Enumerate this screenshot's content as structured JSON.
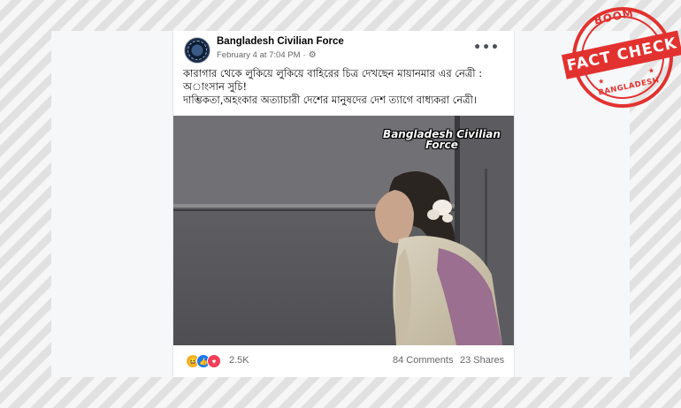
{
  "post": {
    "page_name": "Bangladesh Civilian Force",
    "timestamp": "February 4 at 7:04 PM",
    "separator": "·",
    "privacy_icon": "gear-icon",
    "more_icon": "•••",
    "text_line_1": "কারাগার থেকে লুকিয়ে লুকিয়ে বাহিরের চিত্র দেখছেন মায়ানমার এর নেত্রী : অাংসান সুচি!",
    "text_line_2": "দাম্ভিকতা,অহংকার অত্যাচারী দেশের মানুষদের দেশ ত্যাগে বাধ্যকরা নেত্রী।",
    "image_watermark_line_1": "Bangladesh Civilian",
    "image_watermark_line_2": "Force"
  },
  "engagement": {
    "reaction_icons": [
      "haha-icon",
      "like-icon",
      "love-icon"
    ],
    "reaction_count": "2.5K",
    "comments": "84 Comments",
    "shares": "23 Shares"
  },
  "stamp": {
    "top_text": "BOOM",
    "banner_text": "FACT CHECK",
    "bottom_text": "BANGLADESH"
  },
  "colors": {
    "stamp_red": "#e2322f",
    "facebook_blue": "#1877f2",
    "meta_gray": "#65676b"
  }
}
